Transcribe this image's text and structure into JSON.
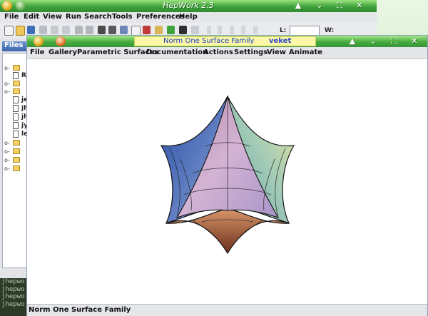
{
  "outer_window": {
    "title": "HepWork 2.3",
    "menu": [
      "File",
      "Edit",
      "View",
      "Run",
      "Search",
      "Tools",
      "Preferences",
      "Help"
    ],
    "l_label": "L:",
    "w_label": "W:"
  },
  "left_panel": {
    "tab_label": "Files",
    "tree_items": [
      {
        "kind": "folder",
        "label": ""
      },
      {
        "kind": "doc",
        "label": "R"
      },
      {
        "kind": "folder",
        "label": ""
      },
      {
        "kind": "folder",
        "label": ""
      },
      {
        "kind": "doc",
        "label": "je"
      },
      {
        "kind": "doc",
        "label": "jh"
      },
      {
        "kind": "doc",
        "label": "jh"
      },
      {
        "kind": "doc",
        "label": "jy"
      },
      {
        "kind": "doc",
        "label": "le"
      },
      {
        "kind": "folder",
        "label": ""
      },
      {
        "kind": "folder",
        "label": ""
      },
      {
        "kind": "folder",
        "label": ""
      },
      {
        "kind": "folder",
        "label": ""
      }
    ],
    "console_lines": [
      "jhepwo",
      "jhepwo",
      "jhepwo",
      "jhepwo"
    ]
  },
  "inner_window": {
    "title": "Norm One Surface Family",
    "tag": "veket",
    "menu": [
      "File",
      "Gallery",
      "Parametric Surfaces",
      "Documentation",
      "Actions",
      "Settings",
      "View",
      "Animate"
    ],
    "status": "Norm One Surface Family"
  },
  "colors": {
    "title_green": "#46ab3d",
    "menu_bg": "#e4e6ea",
    "tag_bg": "#fbf9a8",
    "tag_text": "#1c37c0"
  }
}
